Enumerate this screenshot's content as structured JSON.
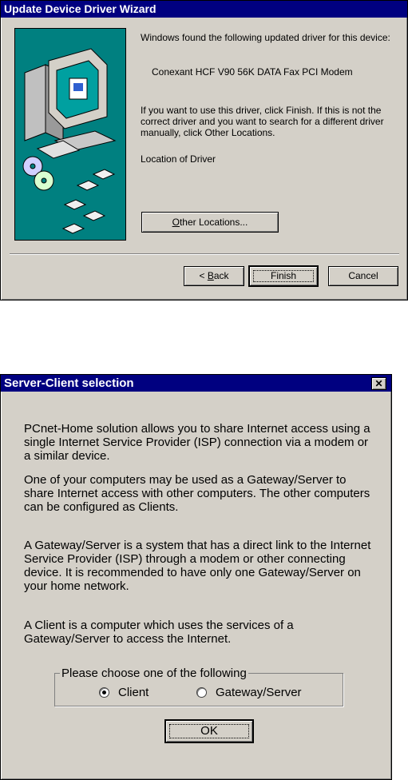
{
  "wizard": {
    "title": "Update Device Driver Wizard",
    "intro": "Windows found the following updated driver for this device:",
    "device_name": "Conexant HCF V90 56K DATA Fax PCI Modem",
    "instructions": "If you want to use this driver, click Finish. If this is not the correct driver and you want to search for a different driver manually, click Other Locations.",
    "location_label": "Location of Driver",
    "other_locations_pre": "",
    "other_locations_accel": "O",
    "other_locations_post": "ther Locations...",
    "back_pre": "< ",
    "back_accel": "B",
    "back_post": "ack",
    "finish_label": "Finish",
    "cancel_label": "Cancel",
    "illustration_bg": "#008080"
  },
  "dialog": {
    "title": "Server-Client selection",
    "close_glyph": "✕",
    "para1": "PCnet-Home solution allows you to share Internet access using a single Internet Service Provider (ISP) connection via a modem or a similar device.",
    "para2": "One of your computers may be used as a Gateway/Server to share Internet access with other computers. The other computers can be configured as Clients.",
    "para3": "A Gateway/Server is a system that has a direct link to the Internet Service Provider (ISP) through a modem or other connecting device. It is recommended to have only one Gateway/Server on your home network.",
    "para4": "A Client is a computer which uses the services of a Gateway/Server to access the Internet.",
    "group_label": "Please choose one of the following",
    "option_client": "Client",
    "option_gateway": "Gateway/Server",
    "selected": "Client",
    "ok_label": "OK"
  }
}
